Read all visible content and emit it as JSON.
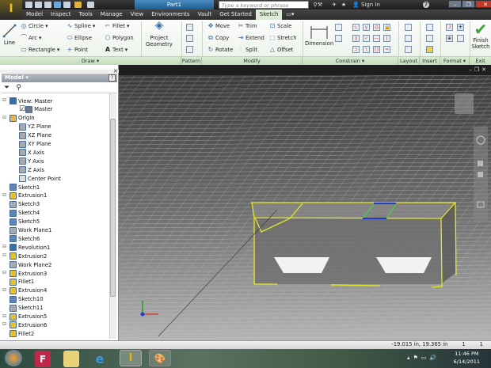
{
  "window": {
    "document_title": "Part1",
    "search_placeholder": "Type a keyword or phrase",
    "sign_in": "Sign In",
    "help": "?"
  },
  "tabs": [
    {
      "label": "Model"
    },
    {
      "label": "Inspect"
    },
    {
      "label": "Tools"
    },
    {
      "label": "Manage"
    },
    {
      "label": "View"
    },
    {
      "label": "Environments"
    },
    {
      "label": "Vault"
    },
    {
      "label": "Get Started"
    },
    {
      "label": "Sketch",
      "active": true
    }
  ],
  "ribbon": {
    "draw": {
      "line": "Line",
      "circle": "Circle",
      "arc": "Arc",
      "rectangle": "Rectangle",
      "spline": "Spline",
      "ellipse": "Ellipse",
      "point": "Point",
      "fillet": "Fillet",
      "polygon": "Polygon",
      "text": "Text"
    },
    "project_geometry": {
      "line1": "Project",
      "line2": "Geometry"
    },
    "modify": {
      "move": "Move",
      "copy": "Copy",
      "rotate": "Rotate",
      "trim": "Trim",
      "extend": "Extend",
      "split": "Split",
      "scale": "Scale",
      "stretch": "Stretch",
      "offset": "Offset"
    },
    "constrain": {
      "dimension": "Dimension"
    },
    "finish": {
      "line1": "Finish",
      "line2": "Sketch"
    },
    "panels": {
      "draw": "Draw ▾",
      "pattern": "Pattern",
      "modify": "Modify",
      "constrain": "Constrain ▾",
      "layout": "Layout",
      "insert": "Insert",
      "format": "Format ▾",
      "exit": "Exit"
    }
  },
  "browser": {
    "title": "Model ▾",
    "help": "?",
    "close": "✕",
    "items": [
      {
        "label": "View: Master",
        "level": 0,
        "icon": "view",
        "color": "#3a6ea5"
      },
      {
        "label": "Master",
        "level": 1,
        "icon": "lock",
        "color": "#777"
      },
      {
        "label": "Origin",
        "level": 0,
        "icon": "folder",
        "color": "#e8b84a"
      },
      {
        "label": "YZ Plane",
        "level": 1,
        "icon": "plane",
        "color": "#aaa"
      },
      {
        "label": "XZ Plane",
        "level": 1,
        "icon": "plane",
        "color": "#aaa"
      },
      {
        "label": "XY Plane",
        "level": 1,
        "icon": "plane",
        "color": "#aaa"
      },
      {
        "label": "X Axis",
        "level": 1,
        "icon": "axis",
        "color": "#aaa"
      },
      {
        "label": "Y Axis",
        "level": 1,
        "icon": "axis",
        "color": "#aaa"
      },
      {
        "label": "Z Axis",
        "level": 1,
        "icon": "axis",
        "color": "#aaa"
      },
      {
        "label": "Center Point",
        "level": 1,
        "icon": "point",
        "color": "#ddd"
      },
      {
        "label": "Sketch1",
        "level": 0,
        "icon": "sketch",
        "color": "#5b86b8"
      },
      {
        "label": "Extrusion1",
        "level": 0,
        "icon": "extrusion",
        "color": "#e8c020"
      },
      {
        "label": "Sketch3",
        "level": 0,
        "icon": "sketch",
        "color": "#aaa"
      },
      {
        "label": "Sketch4",
        "level": 0,
        "icon": "sketch",
        "color": "#5b86b8"
      },
      {
        "label": "Sketch5",
        "level": 0,
        "icon": "sketch",
        "color": "#5b86b8"
      },
      {
        "label": "Work Plane1",
        "level": 0,
        "icon": "plane",
        "color": "#aaa"
      },
      {
        "label": "Sketch6",
        "level": 0,
        "icon": "sketch",
        "color": "#5b86b8"
      },
      {
        "label": "Revolution1",
        "level": 0,
        "icon": "revolution",
        "color": "#3a6ea5"
      },
      {
        "label": "Extrusion2",
        "level": 0,
        "icon": "extrusion",
        "color": "#e8c020"
      },
      {
        "label": "Work Plane2",
        "level": 0,
        "icon": "plane",
        "color": "#aaa"
      },
      {
        "label": "Extrusion3",
        "level": 0,
        "icon": "extrusion",
        "color": "#e8c020"
      },
      {
        "label": "Fillet1",
        "level": 0,
        "icon": "fillet",
        "color": "#e8c020"
      },
      {
        "label": "Extrusion4",
        "level": 0,
        "icon": "extrusion",
        "color": "#e8c020"
      },
      {
        "label": "Sketch10",
        "level": 0,
        "icon": "sketch",
        "color": "#5b86b8"
      },
      {
        "label": "Sketch11",
        "level": 0,
        "icon": "sketch",
        "color": "#aaa"
      },
      {
        "label": "Extrusion5",
        "level": 0,
        "icon": "extrusion",
        "color": "#e8c020"
      },
      {
        "label": "Extrusion6",
        "level": 0,
        "icon": "extrusion",
        "color": "#e8c020"
      },
      {
        "label": "Fillet2",
        "level": 0,
        "icon": "fillet",
        "color": "#e8c020"
      }
    ]
  },
  "status": {
    "coordinates": "-19.015 in, 19.365 in",
    "val1": "1",
    "val2": "1"
  },
  "taskbar": {
    "time": "11:46 PM",
    "date": "6/14/2011"
  },
  "colors": {
    "sketch_line": "#e6e62a",
    "constraint_green": "#4ad04a",
    "selected_blue": "#1e3cc8",
    "ribbon_accent": "#dcebd5"
  }
}
